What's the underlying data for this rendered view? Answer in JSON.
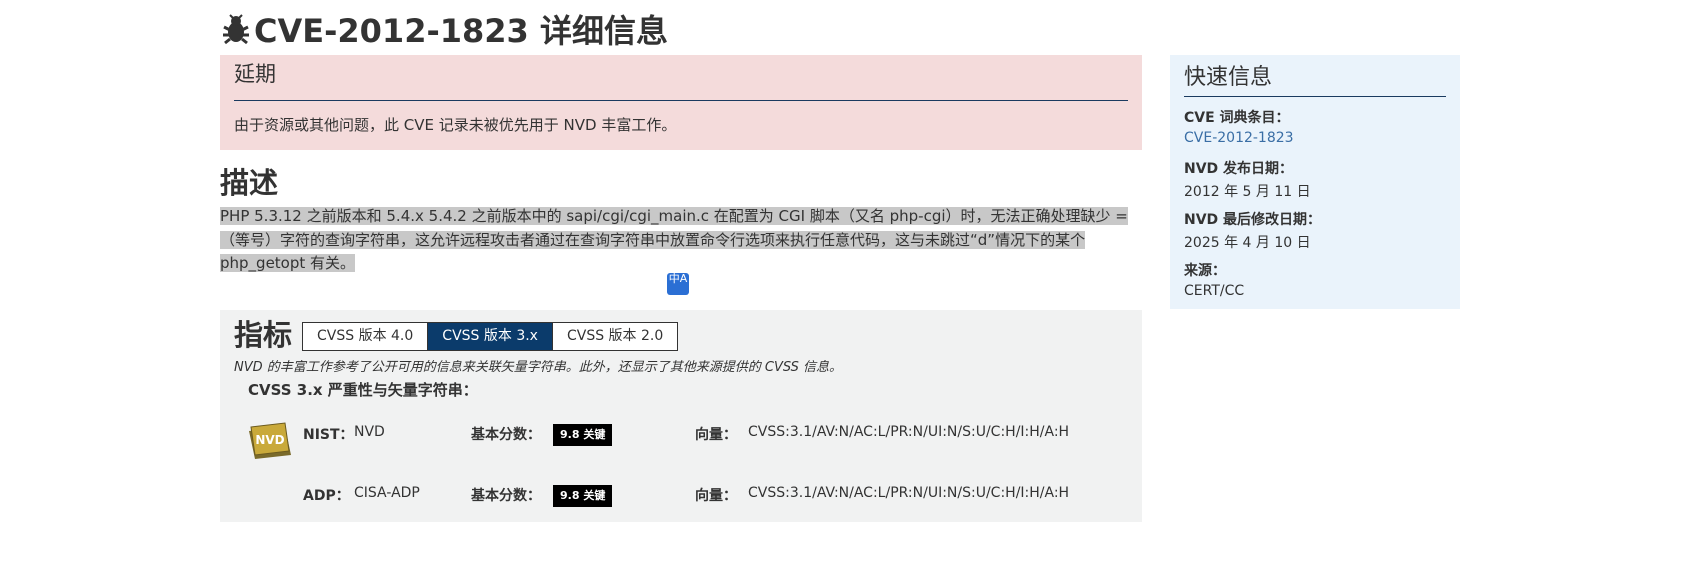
{
  "page": {
    "title": "CVE-2012-1823 详细信息"
  },
  "notice": {
    "title": "延期",
    "text": "由于资源或其他问题，此 CVE 记录未被优先用于 NVD 丰富工作。"
  },
  "description": {
    "heading": "描述",
    "text": "PHP 5.3.12 之前版本和 5.4.x 5.4.2 之前版本中的 sapi/cgi/cgi_main.c 在配置为 CGI 脚本（又名 php-cgi）时，无法正确处理缺少 =（等号）字符的查询字符串，这允许远程攻击者通过在查询字符串中放置命令行选项来执行任意代码，这与未跳过“d”情况下的某个 php_getopt 有关。",
    "translate_icon": "translate-icon",
    "translate_glyph": "中A"
  },
  "metrics": {
    "heading": "指标",
    "tabs": [
      {
        "label": "CVSS 版本 4.0",
        "active": false
      },
      {
        "label": "CVSS 版本 3.x",
        "active": true
      },
      {
        "label": "CVSS 版本 2.0",
        "active": false
      }
    ],
    "note": "NVD 的丰富工作参考了公开可用的信息来关联矢量字符串。此外，还显示了其他来源提供的 CVSS 信息。",
    "subheading": "CVSS 3.x 严重性与矢量字符串：",
    "rows": [
      {
        "source_label": "NIST：",
        "source": "NVD",
        "score_label": "基本分数：",
        "score": "9.8 关键",
        "vector_label": "向量：",
        "vector": "CVSS:3.1/AV:N/AC:L/PR:N/UI:N/S:U/C:H/I:H/A:H"
      },
      {
        "source_label": "ADP：",
        "source": "CISA-ADP",
        "score_label": "基本分数：",
        "score": "9.8 关键",
        "vector_label": "向量：",
        "vector": "CVSS:3.1/AV:N/AC:L/PR:N/UI:N/S:U/C:H/I:H/A:H"
      }
    ],
    "nvd_logo_text": "NVD"
  },
  "quick_info": {
    "title": "快速信息",
    "cve_label": "CVE 词典条目：",
    "cve_value": "CVE-2012-1823",
    "published_label": "NVD 发布日期：",
    "published_value": "2012 年 5 月 11 日",
    "modified_label": "NVD 最后修改日期：",
    "modified_value": "2025 年 4 月 10 日",
    "source_label": "来源：",
    "source_value": "CERT/CC"
  },
  "colors": {
    "notice_bg": "#f4dbdb",
    "metrics_bg": "#f1f2f2",
    "quick_bg": "#eaf3fb",
    "active_tab": "#0b3b6b",
    "link": "#3a6ea5",
    "critical_badge": "#000000"
  }
}
